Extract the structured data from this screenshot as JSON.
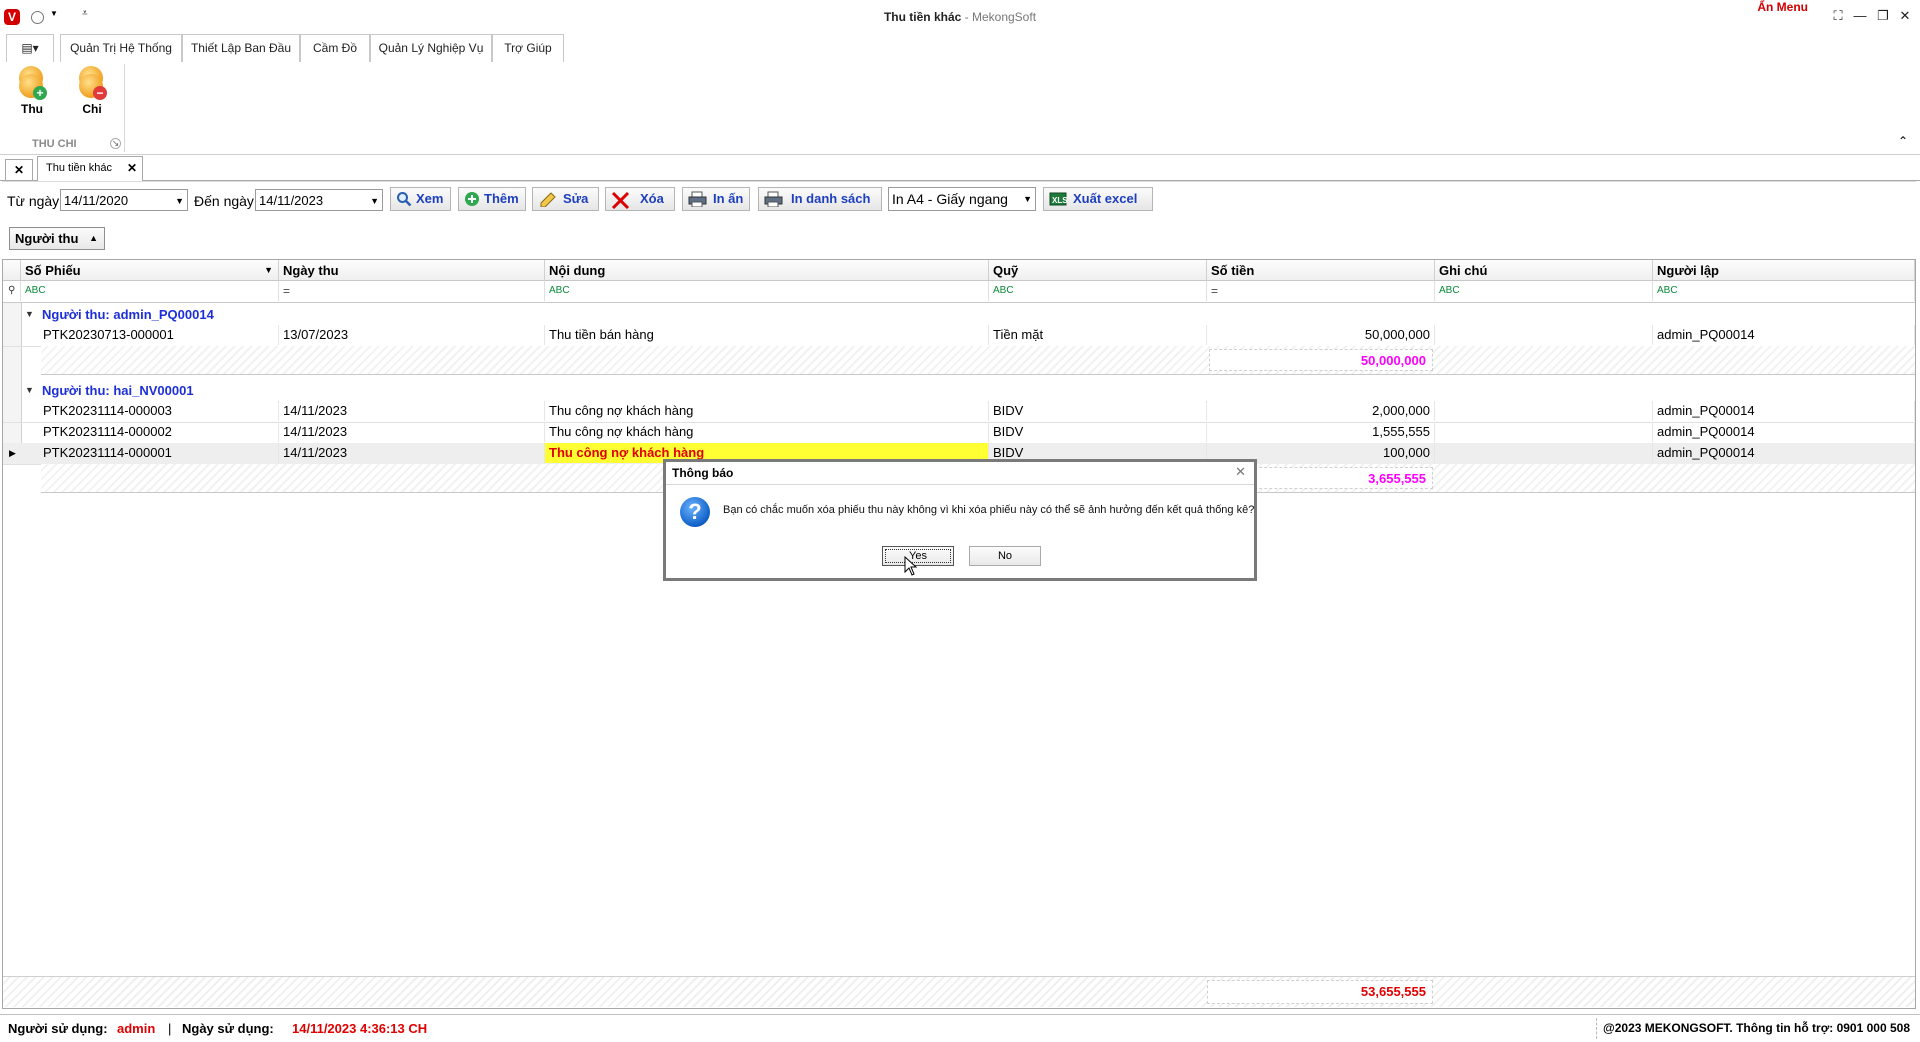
{
  "window": {
    "title_main": "Thu tiền khác",
    "title_sep": " - ",
    "title_app": "MekongSoft",
    "hide_menu": "Ẩn Menu"
  },
  "ribbon_tabs": [
    "Quản Trị Hệ Thống",
    "Thiết Lập Ban Đầu",
    "Cầm Đồ",
    "Quản Lý Nghiệp Vụ",
    "Trợ Giúp"
  ],
  "ribbon": {
    "btn_thu": "Thu",
    "btn_chi": "Chi",
    "group_label": "THU CHI"
  },
  "doc_tab": "Thu tiền khác",
  "toolbar": {
    "from_label": "Từ ngày",
    "from_value": "14/11/2020",
    "to_label": "Đến ngày",
    "to_value": "14/11/2023",
    "view": "Xem",
    "add": "Thêm",
    "edit": "Sửa",
    "delete": "Xóa",
    "print": "In ấn",
    "print_list": "In danh sách",
    "paper": "In A4 - Giấy ngang",
    "export": "Xuất excel"
  },
  "group_chip": "Người thu",
  "columns": [
    "Số Phiếu",
    "Ngày thu",
    "Nội dung",
    "Quỹ",
    "Số tiền",
    "Ghi chú",
    "Người lập"
  ],
  "filters": [
    "ABC",
    "=",
    "ABC",
    "ABC",
    "=",
    "ABC",
    "ABC"
  ],
  "groups": [
    {
      "label": "Người thu: admin_PQ00014",
      "rows": [
        {
          "so_phieu": "PTK20230713-000001",
          "ngay": "13/07/2023",
          "noi_dung": "Thu tiền bán hàng",
          "quy": "Tiền mặt",
          "so_tien": "50,000,000",
          "ghi_chu": "",
          "nguoi_lap": "admin_PQ00014"
        }
      ],
      "total": "50,000,000"
    },
    {
      "label": "Người thu: hai_NV00001",
      "rows": [
        {
          "so_phieu": "PTK20231114-000003",
          "ngay": "14/11/2023",
          "noi_dung": "Thu công nợ khách hàng",
          "quy": "BIDV",
          "so_tien": "2,000,000",
          "ghi_chu": "",
          "nguoi_lap": "admin_PQ00014"
        },
        {
          "so_phieu": "PTK20231114-000002",
          "ngay": "14/11/2023",
          "noi_dung": "Thu công nợ khách hàng",
          "quy": "BIDV",
          "so_tien": "1,555,555",
          "ghi_chu": "",
          "nguoi_lap": "admin_PQ00014"
        },
        {
          "so_phieu": "PTK20231114-000001",
          "ngay": "14/11/2023",
          "noi_dung": "Thu công nợ khách hàng",
          "quy": "BIDV",
          "so_tien": "100,000",
          "ghi_chu": "",
          "nguoi_lap": "admin_PQ00014"
        }
      ],
      "total": "3,655,555"
    }
  ],
  "grand_total": "53,655,555",
  "status": {
    "user_label": "Người sử dụng:",
    "user": "admin",
    "sep": "|",
    "date_label": "Ngày sử dụng:",
    "date": "14/11/2023 4:36:13 CH",
    "copyright": "@2023 MEKONGSOFT. Thông tin hỗ trợ: 0901 000 508"
  },
  "dialog": {
    "title": "Thông báo",
    "message": "Bạn có chắc muốn xóa phiếu thu này không vì khi xóa phiếu này có thể sẽ ảnh hưởng đến kết quả thống kê?",
    "yes": "Yes",
    "no": "No"
  },
  "colors": {
    "link_blue": "#1d3fbf",
    "group_blue": "#1d2fd8",
    "total_magenta": "#ff00ff",
    "grand_red": "#e00000",
    "highlight_yellow": "#ffff33"
  }
}
